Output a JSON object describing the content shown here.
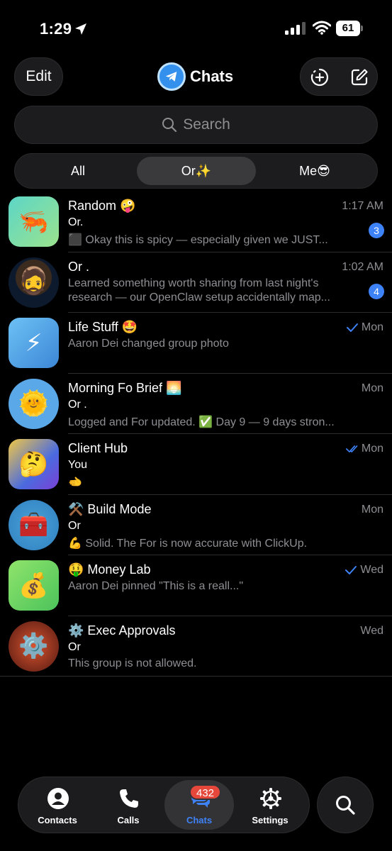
{
  "status_bar": {
    "time": "1:29",
    "battery": "61"
  },
  "header": {
    "edit_label": "Edit",
    "title": "Chats"
  },
  "search": {
    "placeholder": "Search"
  },
  "folders": [
    {
      "label": "All",
      "active": false
    },
    {
      "label": "Or✨",
      "active": true
    },
    {
      "label": "Me😎",
      "active": false
    }
  ],
  "chats": [
    {
      "avatar": "🦐",
      "name": "Random 🤪",
      "time": "1:17 AM",
      "sender": "Or.",
      "preview": "⬛ Okay this is spicy — especially given we JUST...",
      "unread": "3"
    },
    {
      "avatar": "🧔",
      "name": "Or .",
      "time": "1:02 AM",
      "preview": "Learned something worth sharing from last night's research — our OpenClaw setup accidentally map...",
      "unread": "4"
    },
    {
      "avatar": "⚡",
      "name": "Life Stuff 🤩",
      "time": "Mon",
      "read": "single",
      "preview": "Aaron Dei changed group photo"
    },
    {
      "avatar": "🌞",
      "name": "Morning Fo  Brief 🌅",
      "time": "Mon",
      "sender": "Or .",
      "preview": "Logged and For updated. ✅ Day 9 — 9 days stron..."
    },
    {
      "avatar": "🤔",
      "name": "Client Hub",
      "time": "Mon",
      "read": "double",
      "sender": "You",
      "preview": "🫲"
    },
    {
      "avatar": "🧰",
      "name": "⚒️ Build Mode",
      "time": "Mon",
      "sender": "Or",
      "preview": "💪 Solid. The For is now accurate with ClickUp."
    },
    {
      "avatar": "💰",
      "name": "🤑 Money Lab",
      "time": "Wed",
      "read": "single",
      "preview": "Aaron Dei pinned \"This is a reall...\""
    },
    {
      "avatar": "⚙️",
      "name": "⚙️ Exec Approvals",
      "time": "Wed",
      "sender": "Or",
      "preview": "This group is not allowed."
    }
  ],
  "tab_bar": {
    "contacts": "Contacts",
    "calls": "Calls",
    "chats": "Chats",
    "chats_badge": "432",
    "settings": "Settings"
  },
  "colors": {
    "accent": "#3e82f7",
    "badge": "#e5483a",
    "background": "#000000"
  }
}
